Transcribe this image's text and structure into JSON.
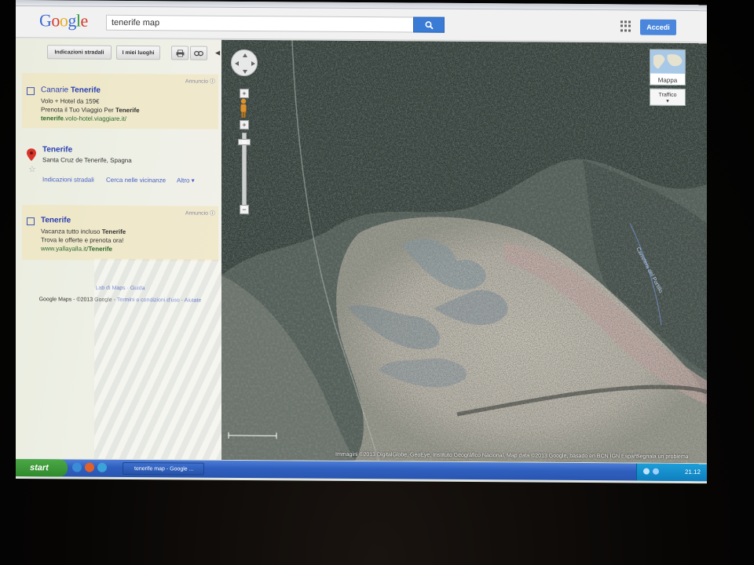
{
  "search": {
    "query": "tenerife map"
  },
  "header": {
    "logo": "Google",
    "signin_label": "Accedi"
  },
  "toolbar": {
    "directions_label": "Indicazioni stradali",
    "myplaces_label": "I miei luoghi"
  },
  "ad1": {
    "label": "Annuncio",
    "title_plain": "Canarie ",
    "title_bold": "Tenerife",
    "line1": "Volo + Hotel da 159€",
    "line2_plain": "Prenota il Tuo Viaggio Per ",
    "line2_bold": "Tenerife",
    "url_bold": "tenerife",
    "url_rest": ".volo-hotel.viaggiare.it/"
  },
  "result": {
    "title": "Tenerife",
    "address": "Santa Cruz de Tenerife, Spagna",
    "link_directions": "Indicazioni stradali",
    "link_nearby": "Cerca nelle vicinanze",
    "link_more": "Altro ▾"
  },
  "ad2": {
    "label": "Annuncio",
    "title": "Tenerife",
    "line1_plain": "Vacanza tutto incluso ",
    "line1_bold": "Tenerife",
    "line2": "Trova le offerte e prenota ora!",
    "url_plain": "www.yallayalla.it/",
    "url_bold": "Tenerife"
  },
  "footer": {
    "lab": "Lab di Maps",
    "guide": "Guida",
    "copy": "Google Maps - ©2013 Google -",
    "terms": "Termini e condizioni d'uso",
    "help": "Aiutate"
  },
  "map": {
    "type_label": "Mappa",
    "traffic_label": "Traffico",
    "copyright": "Immagini ©2013 DigitalGlobe, GeoEye, Instituto Geográfico Nacional, Map data ©2013 Google, basado en BCN IGN España",
    "report": "Segnala un problema",
    "road_label": "Carretera del Portillo"
  },
  "taskbar": {
    "start_label": "start",
    "task_label": "tenerife map - Google ...",
    "clock": "21.12"
  },
  "colors": {
    "link_blue": "#2a3fb0",
    "accent_blue": "#4a87dc",
    "ad_bg": "#f0e2b4",
    "url_green": "#2c6a2c"
  }
}
